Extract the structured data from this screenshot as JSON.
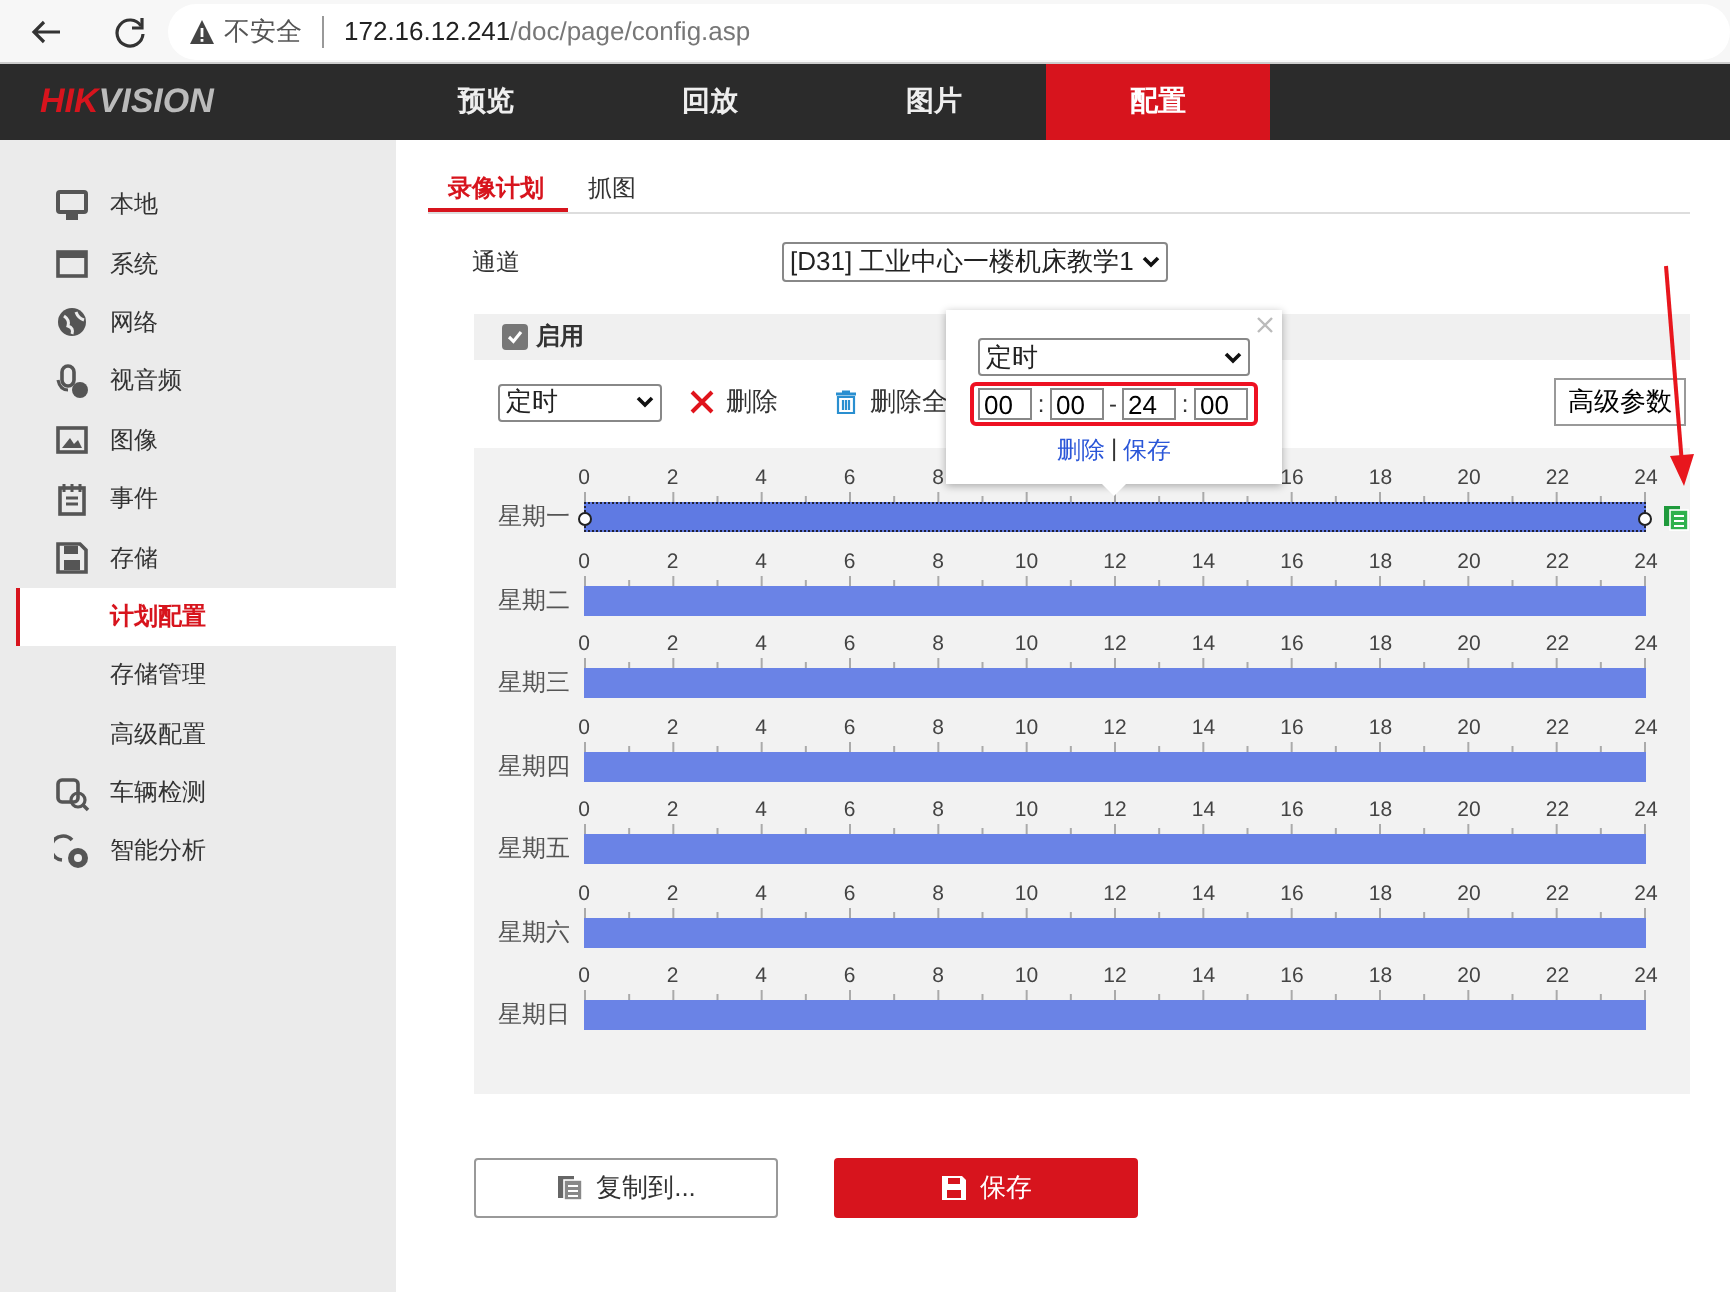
{
  "browser": {
    "security_label": "不安全",
    "url_host": "172.16.12.241",
    "url_path": "/doc/page/config.asp"
  },
  "header": {
    "logo_red": "HIK",
    "logo_rest": "VISION",
    "nav": [
      {
        "label": "预览",
        "selected": false
      },
      {
        "label": "回放",
        "selected": false
      },
      {
        "label": "图片",
        "selected": false
      },
      {
        "label": "配置",
        "selected": true
      }
    ]
  },
  "sidebar": {
    "items": [
      {
        "label": "本地",
        "kind": "section",
        "selected": false
      },
      {
        "label": "系统",
        "kind": "section",
        "selected": false
      },
      {
        "label": "网络",
        "kind": "section",
        "selected": false
      },
      {
        "label": "视音频",
        "kind": "section",
        "selected": false
      },
      {
        "label": "图像",
        "kind": "section",
        "selected": false
      },
      {
        "label": "事件",
        "kind": "section",
        "selected": false
      },
      {
        "label": "存储",
        "kind": "section",
        "selected": false
      },
      {
        "label": "计划配置",
        "kind": "sub",
        "selected": true
      },
      {
        "label": "存储管理",
        "kind": "sub",
        "selected": false
      },
      {
        "label": "高级配置",
        "kind": "sub",
        "selected": false
      },
      {
        "label": "车辆检测",
        "kind": "section",
        "selected": false
      },
      {
        "label": "智能分析",
        "kind": "section",
        "selected": false
      }
    ]
  },
  "tabs": [
    {
      "label": "录像计划",
      "selected": true
    },
    {
      "label": "抓图",
      "selected": false
    }
  ],
  "channel": {
    "label": "通道",
    "value": "[D31] 工业中心一楼机床教学1"
  },
  "schedule": {
    "enabled_label": "启用",
    "enabled": true,
    "mode": "定时",
    "delete_label": "删除",
    "delete_all_label": "删除全",
    "advanced_button": "高级参数",
    "days": [
      {
        "label": "星期一",
        "selected": true,
        "ticks": [
          "0",
          "2",
          "4",
          "6",
          "8"
        ],
        "ticks_end": [
          "16",
          "18",
          "20",
          "22",
          "24"
        ]
      },
      {
        "label": "星期二",
        "selected": false,
        "ticks": [
          "0",
          "2",
          "4",
          "6",
          "8",
          "10",
          "12",
          "14",
          "16",
          "18",
          "20",
          "22",
          "24"
        ]
      },
      {
        "label": "星期三",
        "selected": false,
        "ticks": [
          "0",
          "2",
          "4",
          "6",
          "8",
          "10",
          "12",
          "14",
          "16",
          "18",
          "20",
          "22",
          "24"
        ]
      },
      {
        "label": "星期四",
        "selected": false,
        "ticks": [
          "0",
          "2",
          "4",
          "6",
          "8",
          "10",
          "12",
          "14",
          "16",
          "18",
          "20",
          "22",
          "24"
        ]
      },
      {
        "label": "星期五",
        "selected": false,
        "ticks": [
          "0",
          "2",
          "4",
          "6",
          "8",
          "10",
          "12",
          "14",
          "16",
          "18",
          "20",
          "22",
          "24"
        ]
      },
      {
        "label": "星期六",
        "selected": false,
        "ticks": [
          "0",
          "2",
          "4",
          "6",
          "8",
          "10",
          "12",
          "14",
          "16",
          "18",
          "20",
          "22",
          "24"
        ]
      },
      {
        "label": "星期日",
        "selected": false,
        "ticks": [
          "0",
          "2",
          "4",
          "6",
          "8",
          "10",
          "12",
          "14",
          "16",
          "18",
          "20",
          "22",
          "24"
        ]
      }
    ]
  },
  "editor": {
    "mode": "定时",
    "fields": [
      "00",
      "00",
      "24",
      "00"
    ],
    "separators": [
      ":",
      "-",
      ":"
    ],
    "delete_link": "删除",
    "divider": "|",
    "save_link": "保存"
  },
  "buttons": {
    "copy": "复制到...",
    "save": "保存"
  }
}
